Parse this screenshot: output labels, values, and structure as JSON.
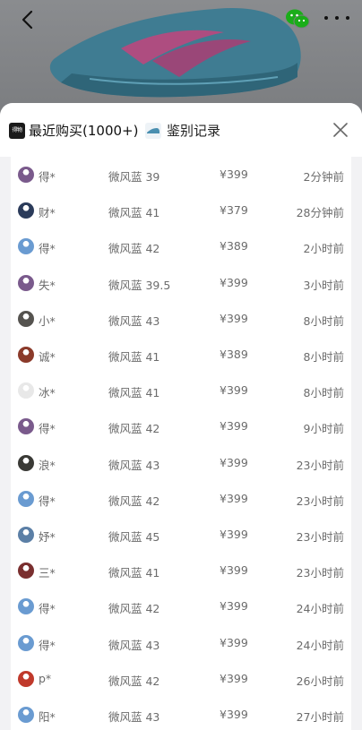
{
  "hero": {
    "image": "basketball-shoe-product-image"
  },
  "topbar": {
    "back_icon": "chevron-left-icon",
    "share_icon": "wechat-icon",
    "more_icon": "more-dots-icon"
  },
  "sheet": {
    "tab_recent": {
      "logo_text": "得物",
      "label": "最近购买(1000+)"
    },
    "tab_auth": {
      "label": "鉴别记录"
    },
    "close_icon": "close-icon"
  },
  "purchases": [
    {
      "user": "得*",
      "size": "微风蓝 39",
      "price": "¥399",
      "time": "2分钟前",
      "avatar_color": "#7a5a8c"
    },
    {
      "user": "财*",
      "size": "微风蓝 41",
      "price": "¥379",
      "time": "28分钟前",
      "avatar_color": "#2b3b5a"
    },
    {
      "user": "得*",
      "size": "微风蓝 42",
      "price": "¥389",
      "time": "2小时前",
      "avatar_color": "#6a9bd1"
    },
    {
      "user": "失*",
      "size": "微风蓝 39.5",
      "price": "¥399",
      "time": "3小时前",
      "avatar_color": "#7a5a8c"
    },
    {
      "user": "小*",
      "size": "微风蓝 43",
      "price": "¥399",
      "time": "8小时前",
      "avatar_color": "#55534f"
    },
    {
      "user": "诚*",
      "size": "微风蓝 41",
      "price": "¥389",
      "time": "8小时前",
      "avatar_color": "#8b3a2a"
    },
    {
      "user": "冰*",
      "size": "微风蓝 41",
      "price": "¥399",
      "time": "8小时前",
      "avatar_color": "#e8e8e8"
    },
    {
      "user": "得*",
      "size": "微风蓝 42",
      "price": "¥399",
      "time": "9小时前",
      "avatar_color": "#7a5a8c"
    },
    {
      "user": "浪*",
      "size": "微风蓝 43",
      "price": "¥399",
      "time": "23小时前",
      "avatar_color": "#3a3a36"
    },
    {
      "user": "得*",
      "size": "微风蓝 42",
      "price": "¥399",
      "time": "23小时前",
      "avatar_color": "#6a9bd1"
    },
    {
      "user": "妤*",
      "size": "微风蓝 45",
      "price": "¥399",
      "time": "23小时前",
      "avatar_color": "#5b7fa6"
    },
    {
      "user": "三*",
      "size": "微风蓝 41",
      "price": "¥399",
      "time": "23小时前",
      "avatar_color": "#7a2f2f"
    },
    {
      "user": "得*",
      "size": "微风蓝 42",
      "price": "¥399",
      "time": "24小时前",
      "avatar_color": "#6a9bd1"
    },
    {
      "user": "得*",
      "size": "微风蓝 43",
      "price": "¥399",
      "time": "24小时前",
      "avatar_color": "#6a9bd1"
    },
    {
      "user": "p*",
      "size": "微风蓝 42",
      "price": "¥399",
      "time": "26小时前",
      "avatar_color": "#c0392b"
    },
    {
      "user": "阳*",
      "size": "微风蓝 43",
      "price": "¥399",
      "time": "27小时前",
      "avatar_color": "#6a9bd1"
    }
  ]
}
